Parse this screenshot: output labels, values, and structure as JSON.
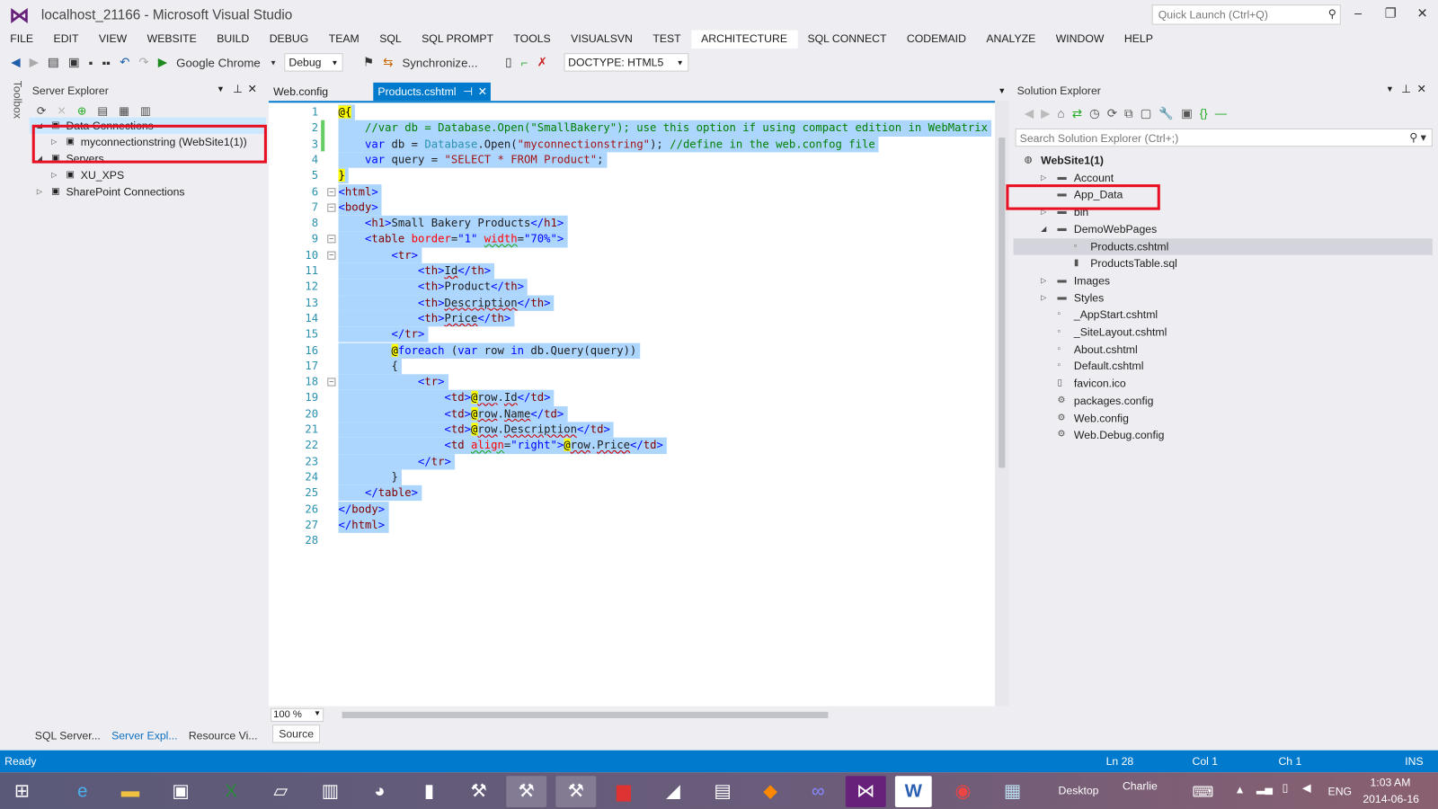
{
  "window": {
    "title": "localhost_21166 - Microsoft Visual Studio",
    "quick_launch": "Quick Launch (Ctrl+Q)"
  },
  "menu": [
    "FILE",
    "EDIT",
    "VIEW",
    "WEBSITE",
    "BUILD",
    "DEBUG",
    "TEAM",
    "SQL",
    "SQL PROMPT",
    "TOOLS",
    "VISUALSVN",
    "TEST",
    "ARCHITECTURE",
    "SQL CONNECT",
    "CODEMAID",
    "ANALYZE",
    "WINDOW",
    "HELP"
  ],
  "toolbar": {
    "browser": "Google Chrome",
    "config": "Debug",
    "sync": "Synchronize...",
    "doctype": "DOCTYPE: HTML5"
  },
  "toolbox_label": "Toolbox",
  "server_explorer": {
    "title": "Server Explorer",
    "items": [
      {
        "label": "Data Connections",
        "level": 0,
        "expanded": true,
        "icon": "database-icon",
        "selected": true
      },
      {
        "label": "myconnectionstring (WebSite1(1))",
        "level": 1,
        "expanded": false,
        "icon": "connection-icon"
      },
      {
        "label": "Servers",
        "level": 0,
        "expanded": true,
        "icon": "servers-icon"
      },
      {
        "label": "XU_XPS",
        "level": 1,
        "expanded": false,
        "icon": "server-icon"
      },
      {
        "label": "SharePoint Connections",
        "level": 0,
        "expanded": false,
        "icon": "sharepoint-icon"
      }
    ],
    "bottom_tabs": [
      "SQL Server...",
      "Server Expl...",
      "Resource Vi..."
    ]
  },
  "editor": {
    "tabs": [
      "Web.config",
      "Products.cshtml"
    ],
    "zoom": "100 %",
    "source_button": "Source",
    "lines": [
      "@{",
      "    //var db = Database.Open(\"SmallBakery\"); use this option if using compact edition in WebMatrix",
      "    var db = Database.Open(\"myconnectionstring\"); //define in the web.confog file",
      "    var query = \"SELECT * FROM Product\";",
      "}",
      "<html>",
      "<body>",
      "    <h1>Small Bakery Products</h1>",
      "    <table border=\"1\" width=\"70%\">",
      "        <tr>",
      "            <th>Id</th>",
      "            <th>Product</th>",
      "            <th>Description</th>",
      "            <th>Price</th>",
      "        </tr>",
      "        @foreach (var row in db.Query(query))",
      "        {",
      "            <tr>",
      "                <td>@row.Id</td>",
      "                <td>@row.Name</td>",
      "                <td>@row.Description</td>",
      "                <td align=\"right\">@row.Price</td>",
      "            </tr>",
      "        }",
      "    </table>",
      "</body>",
      "</html>",
      ""
    ]
  },
  "solution_explorer": {
    "title": "Solution Explorer",
    "search_placeholder": "Search Solution Explorer (Ctrl+;)",
    "items": [
      {
        "label": "WebSite1(1)",
        "level": 0,
        "icon": "website-icon",
        "bold": true
      },
      {
        "label": "Account",
        "level": 1,
        "icon": "folder-icon",
        "arrow": "collapsed"
      },
      {
        "label": "App_Data",
        "level": 1,
        "icon": "folder-icon",
        "arrow": ""
      },
      {
        "label": "bin",
        "level": 1,
        "icon": "folder-icon",
        "arrow": "collapsed"
      },
      {
        "label": "DemoWebPages",
        "level": 1,
        "icon": "folder-icon",
        "arrow": "expanded"
      },
      {
        "label": "Products.cshtml",
        "level": 2,
        "icon": "cshtml-icon",
        "selected": true
      },
      {
        "label": "ProductsTable.sql",
        "level": 2,
        "icon": "sql-icon"
      },
      {
        "label": "Images",
        "level": 1,
        "icon": "folder-icon",
        "arrow": "collapsed"
      },
      {
        "label": "Styles",
        "level": 1,
        "icon": "folder-icon",
        "arrow": "collapsed"
      },
      {
        "label": "_AppStart.cshtml",
        "level": 1,
        "icon": "cshtml-icon"
      },
      {
        "label": "_SiteLayout.cshtml",
        "level": 1,
        "icon": "cshtml-icon"
      },
      {
        "label": "About.cshtml",
        "level": 1,
        "icon": "cshtml-icon"
      },
      {
        "label": "Default.cshtml",
        "level": 1,
        "icon": "cshtml-icon"
      },
      {
        "label": "favicon.ico",
        "level": 1,
        "icon": "file-icon"
      },
      {
        "label": "packages.config",
        "level": 1,
        "icon": "config-icon"
      },
      {
        "label": "Web.config",
        "level": 1,
        "icon": "config-icon"
      },
      {
        "label": "Web.Debug.config",
        "level": 1,
        "icon": "config-icon"
      }
    ]
  },
  "status": {
    "text": "Ready",
    "ln": "Ln 28",
    "col": "Col 1",
    "ch": "Ch 1",
    "mode": "INS"
  },
  "taskbar": {
    "desktop": "Desktop",
    "user": "Charlie",
    "lang": "ENG",
    "time": "1:03 AM",
    "date": "2014-06-16"
  },
  "colors": {
    "accent": "#007acc",
    "highlight": "#e81123",
    "selection": "#add6ff"
  }
}
